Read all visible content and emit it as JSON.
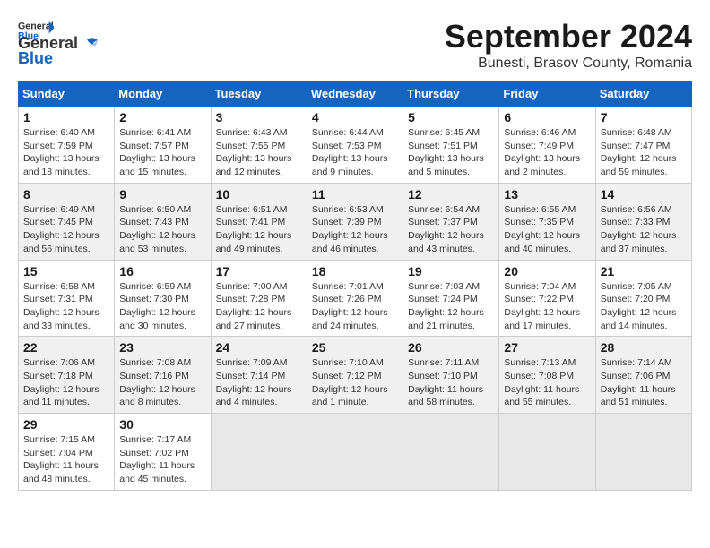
{
  "header": {
    "logo_line1": "General",
    "logo_line2": "Blue",
    "title": "September 2024",
    "subtitle": "Bunesti, Brasov County, Romania"
  },
  "calendar": {
    "days_of_week": [
      "Sunday",
      "Monday",
      "Tuesday",
      "Wednesday",
      "Thursday",
      "Friday",
      "Saturday"
    ],
    "weeks": [
      [
        {
          "day": "1",
          "info": "Sunrise: 6:40 AM\nSunset: 7:59 PM\nDaylight: 13 hours and 18 minutes."
        },
        {
          "day": "2",
          "info": "Sunrise: 6:41 AM\nSunset: 7:57 PM\nDaylight: 13 hours and 15 minutes."
        },
        {
          "day": "3",
          "info": "Sunrise: 6:43 AM\nSunset: 7:55 PM\nDaylight: 13 hours and 12 minutes."
        },
        {
          "day": "4",
          "info": "Sunrise: 6:44 AM\nSunset: 7:53 PM\nDaylight: 13 hours and 9 minutes."
        },
        {
          "day": "5",
          "info": "Sunrise: 6:45 AM\nSunset: 7:51 PM\nDaylight: 13 hours and 5 minutes."
        },
        {
          "day": "6",
          "info": "Sunrise: 6:46 AM\nSunset: 7:49 PM\nDaylight: 13 hours and 2 minutes."
        },
        {
          "day": "7",
          "info": "Sunrise: 6:48 AM\nSunset: 7:47 PM\nDaylight: 12 hours and 59 minutes."
        }
      ],
      [
        {
          "day": "8",
          "info": "Sunrise: 6:49 AM\nSunset: 7:45 PM\nDaylight: 12 hours and 56 minutes."
        },
        {
          "day": "9",
          "info": "Sunrise: 6:50 AM\nSunset: 7:43 PM\nDaylight: 12 hours and 53 minutes."
        },
        {
          "day": "10",
          "info": "Sunrise: 6:51 AM\nSunset: 7:41 PM\nDaylight: 12 hours and 49 minutes."
        },
        {
          "day": "11",
          "info": "Sunrise: 6:53 AM\nSunset: 7:39 PM\nDaylight: 12 hours and 46 minutes."
        },
        {
          "day": "12",
          "info": "Sunrise: 6:54 AM\nSunset: 7:37 PM\nDaylight: 12 hours and 43 minutes."
        },
        {
          "day": "13",
          "info": "Sunrise: 6:55 AM\nSunset: 7:35 PM\nDaylight: 12 hours and 40 minutes."
        },
        {
          "day": "14",
          "info": "Sunrise: 6:56 AM\nSunset: 7:33 PM\nDaylight: 12 hours and 37 minutes."
        }
      ],
      [
        {
          "day": "15",
          "info": "Sunrise: 6:58 AM\nSunset: 7:31 PM\nDaylight: 12 hours and 33 minutes."
        },
        {
          "day": "16",
          "info": "Sunrise: 6:59 AM\nSunset: 7:30 PM\nDaylight: 12 hours and 30 minutes."
        },
        {
          "day": "17",
          "info": "Sunrise: 7:00 AM\nSunset: 7:28 PM\nDaylight: 12 hours and 27 minutes."
        },
        {
          "day": "18",
          "info": "Sunrise: 7:01 AM\nSunset: 7:26 PM\nDaylight: 12 hours and 24 minutes."
        },
        {
          "day": "19",
          "info": "Sunrise: 7:03 AM\nSunset: 7:24 PM\nDaylight: 12 hours and 21 minutes."
        },
        {
          "day": "20",
          "info": "Sunrise: 7:04 AM\nSunset: 7:22 PM\nDaylight: 12 hours and 17 minutes."
        },
        {
          "day": "21",
          "info": "Sunrise: 7:05 AM\nSunset: 7:20 PM\nDaylight: 12 hours and 14 minutes."
        }
      ],
      [
        {
          "day": "22",
          "info": "Sunrise: 7:06 AM\nSunset: 7:18 PM\nDaylight: 12 hours and 11 minutes."
        },
        {
          "day": "23",
          "info": "Sunrise: 7:08 AM\nSunset: 7:16 PM\nDaylight: 12 hours and 8 minutes."
        },
        {
          "day": "24",
          "info": "Sunrise: 7:09 AM\nSunset: 7:14 PM\nDaylight: 12 hours and 4 minutes."
        },
        {
          "day": "25",
          "info": "Sunrise: 7:10 AM\nSunset: 7:12 PM\nDaylight: 12 hours and 1 minute."
        },
        {
          "day": "26",
          "info": "Sunrise: 7:11 AM\nSunset: 7:10 PM\nDaylight: 11 hours and 58 minutes."
        },
        {
          "day": "27",
          "info": "Sunrise: 7:13 AM\nSunset: 7:08 PM\nDaylight: 11 hours and 55 minutes."
        },
        {
          "day": "28",
          "info": "Sunrise: 7:14 AM\nSunset: 7:06 PM\nDaylight: 11 hours and 51 minutes."
        }
      ],
      [
        {
          "day": "29",
          "info": "Sunrise: 7:15 AM\nSunset: 7:04 PM\nDaylight: 11 hours and 48 minutes."
        },
        {
          "day": "30",
          "info": "Sunrise: 7:17 AM\nSunset: 7:02 PM\nDaylight: 11 hours and 45 minutes."
        },
        {
          "day": "",
          "info": ""
        },
        {
          "day": "",
          "info": ""
        },
        {
          "day": "",
          "info": ""
        },
        {
          "day": "",
          "info": ""
        },
        {
          "day": "",
          "info": ""
        }
      ]
    ]
  }
}
